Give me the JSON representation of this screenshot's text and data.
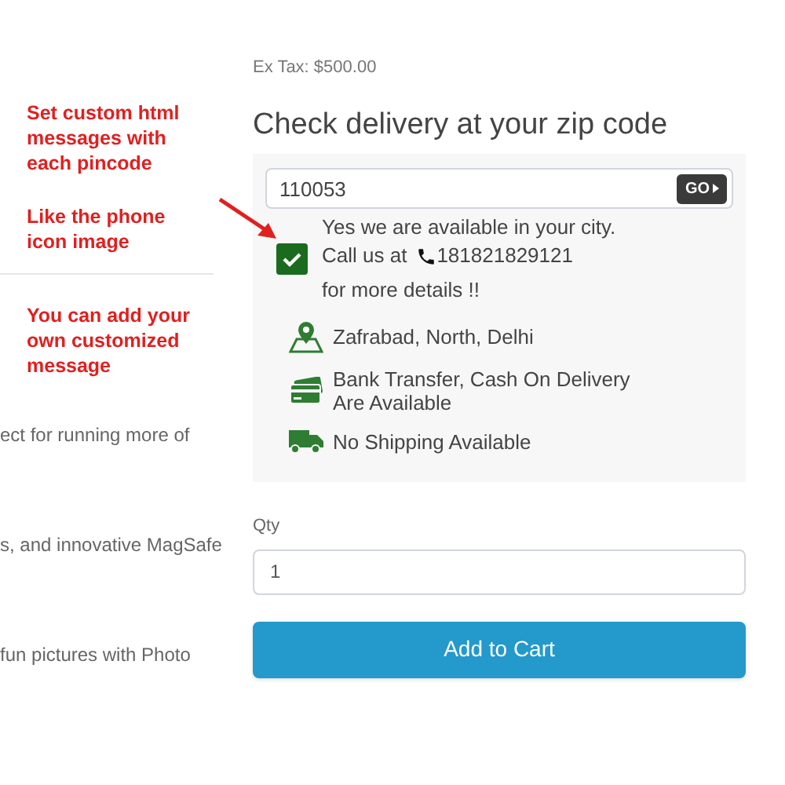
{
  "notes": [
    {
      "kind": "note",
      "text": "Set custom html messages with each pincode"
    },
    {
      "kind": "note",
      "text": "Like the phone icon image"
    },
    {
      "kind": "divider"
    },
    {
      "kind": "note",
      "text": "You can add your own customized message"
    },
    {
      "kind": "cut",
      "text": "ect for running more of"
    },
    {
      "kind": "cut",
      "text": "s, and innovative MagSafe"
    },
    {
      "kind": "cut",
      "text": "fun pictures with Photo"
    }
  ],
  "ex_tax": "Ex Tax: $500.00",
  "heading": "Check delivery at your zip code",
  "zip": {
    "value": "110053",
    "button": "GO"
  },
  "availability": {
    "line1": "Yes we are available in your city.",
    "call_label": "Call us at",
    "phone": "181821829121",
    "line3": "for more details !!"
  },
  "details": [
    {
      "kind": "location",
      "text": "Zafrabad, North, Delhi"
    },
    {
      "kind": "payment",
      "lines": [
        "Bank Transfer, Cash On Delivery",
        "Are Available"
      ]
    },
    {
      "kind": "shipping",
      "text": "No Shipping Available"
    }
  ],
  "qty": {
    "label": "Qty",
    "value": "1"
  },
  "add_to_cart": "Add to Cart"
}
